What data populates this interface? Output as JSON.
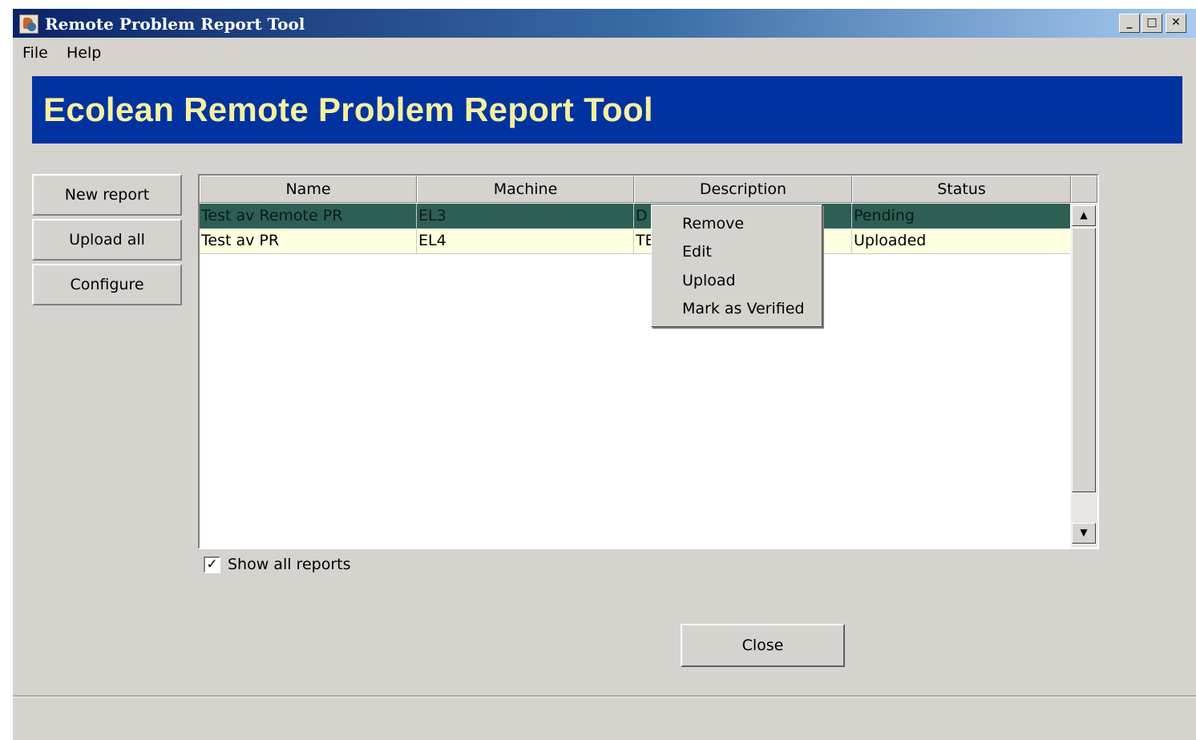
{
  "window": {
    "title": "Remote Problem Report Tool",
    "controls": {
      "minimize": "_",
      "maximize": "□",
      "close": "✕"
    }
  },
  "menu": {
    "file": "File",
    "help": "Help"
  },
  "banner": {
    "title": "Ecolean Remote Problem Report Tool",
    "bg_color": "#0033a0",
    "text_color": "#f5f0a0"
  },
  "sidebar": {
    "new_report": "New report",
    "upload_all": "Upload all",
    "configure": "Configure"
  },
  "table": {
    "columns": [
      "Name",
      "Machine",
      "Description",
      "Status"
    ],
    "rows": [
      {
        "name": "Test av Remote PR",
        "machine": "EL3",
        "description": "D",
        "status": "Pending",
        "selected": true
      },
      {
        "name": "Test av PR",
        "machine": "EL4",
        "description": "TE",
        "status": "Uploaded",
        "selected": false
      }
    ],
    "selected_row_color": "#2d5f55",
    "row_color": "#ffffe0"
  },
  "context_menu": {
    "items": [
      "Remove",
      "Edit",
      "Upload",
      "Mark as Verified"
    ]
  },
  "show_all": {
    "label": "Show all reports",
    "checked": true,
    "check_glyph": "✓"
  },
  "close_button": "Close",
  "icons": [
    "app-icon",
    "checkbox-check-icon",
    "scroll-up-icon",
    "scroll-down-icon"
  ]
}
